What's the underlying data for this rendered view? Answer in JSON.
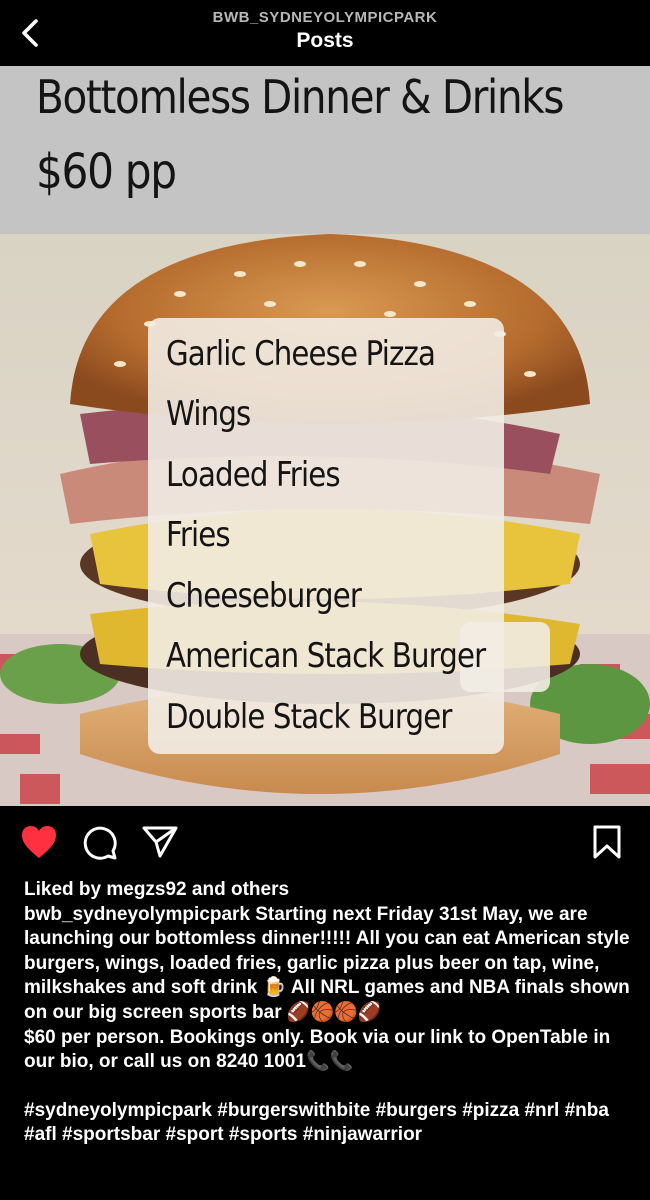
{
  "header": {
    "username": "BWB_SYDNEYOLYMPICPARK",
    "title": "Posts"
  },
  "post_image": {
    "title": "Bottomless Dinner & Drinks",
    "price": "$60 pp",
    "menu": [
      "Garlic Cheese Pizza",
      "Wings",
      "Loaded Fries",
      "Fries",
      "Cheeseburger",
      "American Stack Burger",
      "Double Stack Burger"
    ]
  },
  "actions": {
    "like_icon": "heart-filled-icon",
    "comment_icon": "speech-bubble-icon",
    "share_icon": "paper-plane-icon",
    "save_icon": "bookmark-icon",
    "like_color": "#ff3040"
  },
  "likes": {
    "prefix": "Liked by ",
    "user": "megzs92",
    "joiner": " and ",
    "others": "others"
  },
  "caption": {
    "username": "bwb_sydneyolympicpark",
    "text1": " Starting next Friday 31st May, we are launching our bottomless dinner!!!!! All you can eat American style burgers, wings, loaded fries, garlic pizza plus beer on tap, wine, milkshakes and soft drink 🍺 All NRL games and NBA finals shown on our big screen sports bar 🏈🏀🏀🏈",
    "text2": "$60 per person. Bookings only. Book via our link to OpenTable in our bio, or call us on 8240 1001📞📞",
    "hashtags": "#sydneyolympicpark #burgerswithbite #burgers #pizza #nrl #nba #afl #sportsbar #sport #sports #ninjawarrior"
  }
}
